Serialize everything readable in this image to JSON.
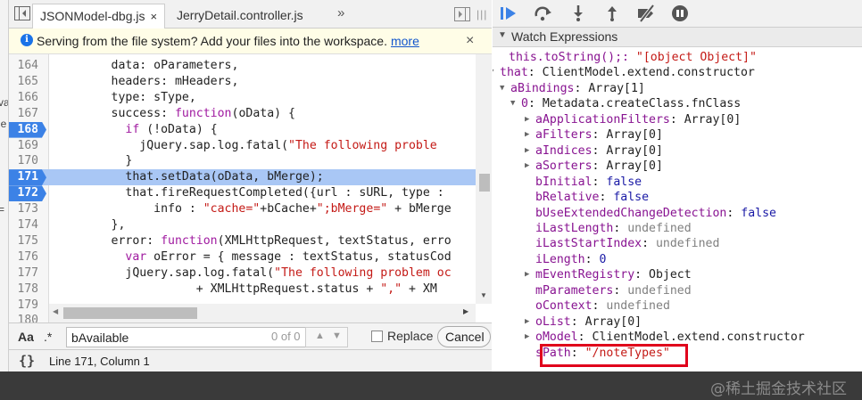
{
  "left_strip": {
    "frag1": "va",
    "frag2": "ie",
    "frag3": "="
  },
  "tabs": [
    {
      "label": "JSONModel-dbg.js",
      "close": "×",
      "active": true
    },
    {
      "label": "JerryDetail.controller.js",
      "active": false
    }
  ],
  "tabs_more": "»",
  "infobar": {
    "text": "Serving from the file system? Add your files into the workspace.",
    "link": "more",
    "close": "×"
  },
  "code_lines": [
    {
      "n": "164",
      "bp": false,
      "hl": false,
      "segs": [
        [
          "p",
          "        data: oParameters,"
        ]
      ]
    },
    {
      "n": "165",
      "bp": false,
      "hl": false,
      "segs": [
        [
          "p",
          "        headers: mHeaders,"
        ]
      ]
    },
    {
      "n": "166",
      "bp": false,
      "hl": false,
      "segs": [
        [
          "p",
          "        type: sType,"
        ]
      ]
    },
    {
      "n": "167",
      "bp": false,
      "hl": false,
      "segs": [
        [
          "p",
          "        success: "
        ],
        [
          "k",
          "function"
        ],
        [
          "p",
          "(oData) {"
        ]
      ]
    },
    {
      "n": "168",
      "bp": true,
      "hl": false,
      "segs": [
        [
          "p",
          "          "
        ],
        [
          "k",
          "if"
        ],
        [
          "p",
          " (!oData) {"
        ]
      ]
    },
    {
      "n": "169",
      "bp": false,
      "hl": false,
      "segs": [
        [
          "p",
          "            jQuery.sap.log.fatal("
        ],
        [
          "s",
          "\"The following proble"
        ]
      ]
    },
    {
      "n": "170",
      "bp": false,
      "hl": false,
      "segs": [
        [
          "p",
          "          }"
        ]
      ]
    },
    {
      "n": "171",
      "bp": true,
      "hl": true,
      "segs": [
        [
          "p",
          "          that.setData(oData, bMerge);"
        ]
      ]
    },
    {
      "n": "172",
      "bp": true,
      "hl": false,
      "segs": [
        [
          "p",
          "          that.fireRequestCompleted({url : sURL, type :"
        ]
      ]
    },
    {
      "n": "173",
      "bp": false,
      "hl": false,
      "segs": [
        [
          "p",
          "              info : "
        ],
        [
          "s",
          "\"cache=\""
        ],
        [
          "p",
          "+bCache+"
        ],
        [
          "s",
          "\";bMerge=\""
        ],
        [
          "p",
          " + bMerge"
        ]
      ]
    },
    {
      "n": "174",
      "bp": false,
      "hl": false,
      "segs": [
        [
          "p",
          "        },"
        ]
      ]
    },
    {
      "n": "175",
      "bp": false,
      "hl": false,
      "segs": [
        [
          "p",
          "        error: "
        ],
        [
          "k",
          "function"
        ],
        [
          "p",
          "(XMLHttpRequest, textStatus, erro"
        ]
      ]
    },
    {
      "n": "176",
      "bp": false,
      "hl": false,
      "segs": [
        [
          "p",
          "          "
        ],
        [
          "k",
          "var"
        ],
        [
          "p",
          " oError = { message : textStatus, statusCod"
        ]
      ]
    },
    {
      "n": "177",
      "bp": false,
      "hl": false,
      "segs": [
        [
          "p",
          "          jQuery.sap.log.fatal("
        ],
        [
          "s",
          "\"The following problem oc"
        ]
      ]
    },
    {
      "n": "178",
      "bp": false,
      "hl": false,
      "segs": [
        [
          "p",
          "                    + XMLHttpRequest.status + "
        ],
        [
          "s",
          "\",\""
        ],
        [
          "p",
          " + XM"
        ]
      ]
    },
    {
      "n": "179",
      "bp": false,
      "hl": false,
      "segs": [
        [
          "p",
          ""
        ]
      ]
    },
    {
      "n": "180",
      "bp": false,
      "hl": false,
      "segs": [
        [
          "p",
          ""
        ]
      ]
    }
  ],
  "search": {
    "case_label": "Aa",
    "regex_label": ".*",
    "value": "bAvailable",
    "count": "0 of 0",
    "replace_label": "Replace",
    "cancel_label": "Cancel"
  },
  "status": {
    "braces": "{}",
    "position": "Line 171, Column 1"
  },
  "watch": {
    "header": "Watch Expressions",
    "rows": [
      {
        "arrow": "",
        "segs": [
          [
            "n",
            "this.toString();: "
          ],
          [
            "s",
            "\"[object Object]\""
          ]
        ]
      },
      {
        "arrow": "▼",
        "segs": [
          [
            "n",
            "that"
          ],
          [
            "p",
            ": ClientModel.extend.constructor"
          ]
        ]
      },
      {
        "arrow": "▼",
        "segs": [
          [
            "n",
            "aBindings"
          ],
          [
            "p",
            ": Array[1]"
          ]
        ]
      },
      {
        "arrow": "▼",
        "segs": [
          [
            "n",
            "0"
          ],
          [
            "p",
            ": Metadata.createClass.fnClass"
          ]
        ]
      },
      {
        "arrow": "▶",
        "segs": [
          [
            "n",
            "aApplicationFilters"
          ],
          [
            "p",
            ": Array[0]"
          ]
        ]
      },
      {
        "arrow": "▶",
        "segs": [
          [
            "n",
            "aFilters"
          ],
          [
            "p",
            ": Array[0]"
          ]
        ]
      },
      {
        "arrow": "▶",
        "segs": [
          [
            "n",
            "aIndices"
          ],
          [
            "p",
            ": Array[0]"
          ]
        ]
      },
      {
        "arrow": "▶",
        "segs": [
          [
            "n",
            "aSorters"
          ],
          [
            "p",
            ": Array[0]"
          ]
        ]
      },
      {
        "arrow": "",
        "segs": [
          [
            "n",
            "bInitial"
          ],
          [
            "p",
            ": "
          ],
          [
            "k",
            "false"
          ]
        ]
      },
      {
        "arrow": "",
        "segs": [
          [
            "n",
            "bRelative"
          ],
          [
            "p",
            ": "
          ],
          [
            "k",
            "false"
          ]
        ]
      },
      {
        "arrow": "",
        "segs": [
          [
            "n",
            "bUseExtendedChangeDetection"
          ],
          [
            "p",
            ": "
          ],
          [
            "k",
            "false"
          ]
        ]
      },
      {
        "arrow": "",
        "segs": [
          [
            "n",
            "iLastLength"
          ],
          [
            "p",
            ": "
          ],
          [
            "u",
            "undefined"
          ]
        ]
      },
      {
        "arrow": "",
        "segs": [
          [
            "n",
            "iLastStartIndex"
          ],
          [
            "p",
            ": "
          ],
          [
            "u",
            "undefined"
          ]
        ]
      },
      {
        "arrow": "",
        "segs": [
          [
            "n",
            "iLength"
          ],
          [
            "p",
            ": "
          ],
          [
            "k",
            "0"
          ]
        ]
      },
      {
        "arrow": "▶",
        "segs": [
          [
            "n",
            "mEventRegistry"
          ],
          [
            "p",
            ": Object"
          ]
        ]
      },
      {
        "arrow": "",
        "segs": [
          [
            "n",
            "mParameters"
          ],
          [
            "p",
            ": "
          ],
          [
            "u",
            "undefined"
          ]
        ]
      },
      {
        "arrow": "",
        "segs": [
          [
            "n",
            "oContext"
          ],
          [
            "p",
            ": "
          ],
          [
            "u",
            "undefined"
          ]
        ]
      },
      {
        "arrow": "▶",
        "segs": [
          [
            "n",
            "oList"
          ],
          [
            "p",
            ": Array[0]"
          ]
        ]
      },
      {
        "arrow": "▶",
        "segs": [
          [
            "n",
            "oModel"
          ],
          [
            "p",
            ": ClientModel.extend.constructor"
          ]
        ]
      },
      {
        "arrow": "",
        "segs": [
          [
            "n",
            "sPath"
          ],
          [
            "p",
            ": "
          ],
          [
            "s",
            "\"/noteTypes\""
          ]
        ]
      }
    ]
  },
  "watermark": "@稀土掘金技术社区",
  "colors": {
    "accent": "#1a73e8",
    "breakpoint": "#3c82e6",
    "highlight_line": "#a9c7f5",
    "annotation": "#e0001b"
  },
  "icons": [
    "toggle-navigator-icon",
    "close-icon",
    "resume-icon",
    "step-over-icon",
    "step-into-icon",
    "step-out-icon",
    "deactivate-breakpoints-icon",
    "pause-on-exceptions-icon",
    "info-icon"
  ]
}
